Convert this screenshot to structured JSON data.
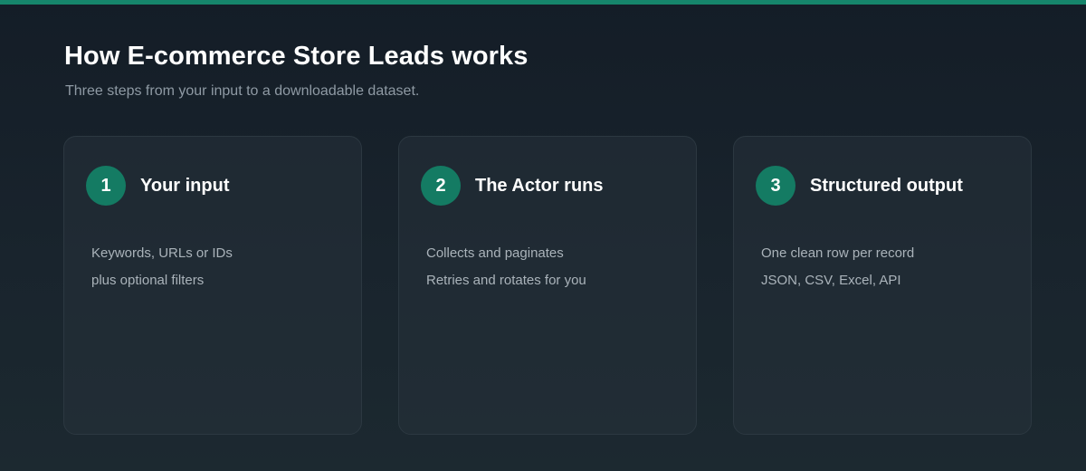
{
  "header": {
    "title": "How E-commerce Store Leads works",
    "subtitle": "Three steps from your input to a downloadable dataset."
  },
  "colors": {
    "accent": "#16856b",
    "badge": "#147b63"
  },
  "steps": [
    {
      "number": "1",
      "title": "Your input",
      "lines": [
        "Keywords, URLs or IDs",
        "plus optional filters"
      ]
    },
    {
      "number": "2",
      "title": "The Actor runs",
      "lines": [
        "Collects and paginates",
        "Retries and rotates for you"
      ]
    },
    {
      "number": "3",
      "title": "Structured output",
      "lines": [
        "One clean row per record",
        "JSON, CSV, Excel, API"
      ]
    }
  ]
}
